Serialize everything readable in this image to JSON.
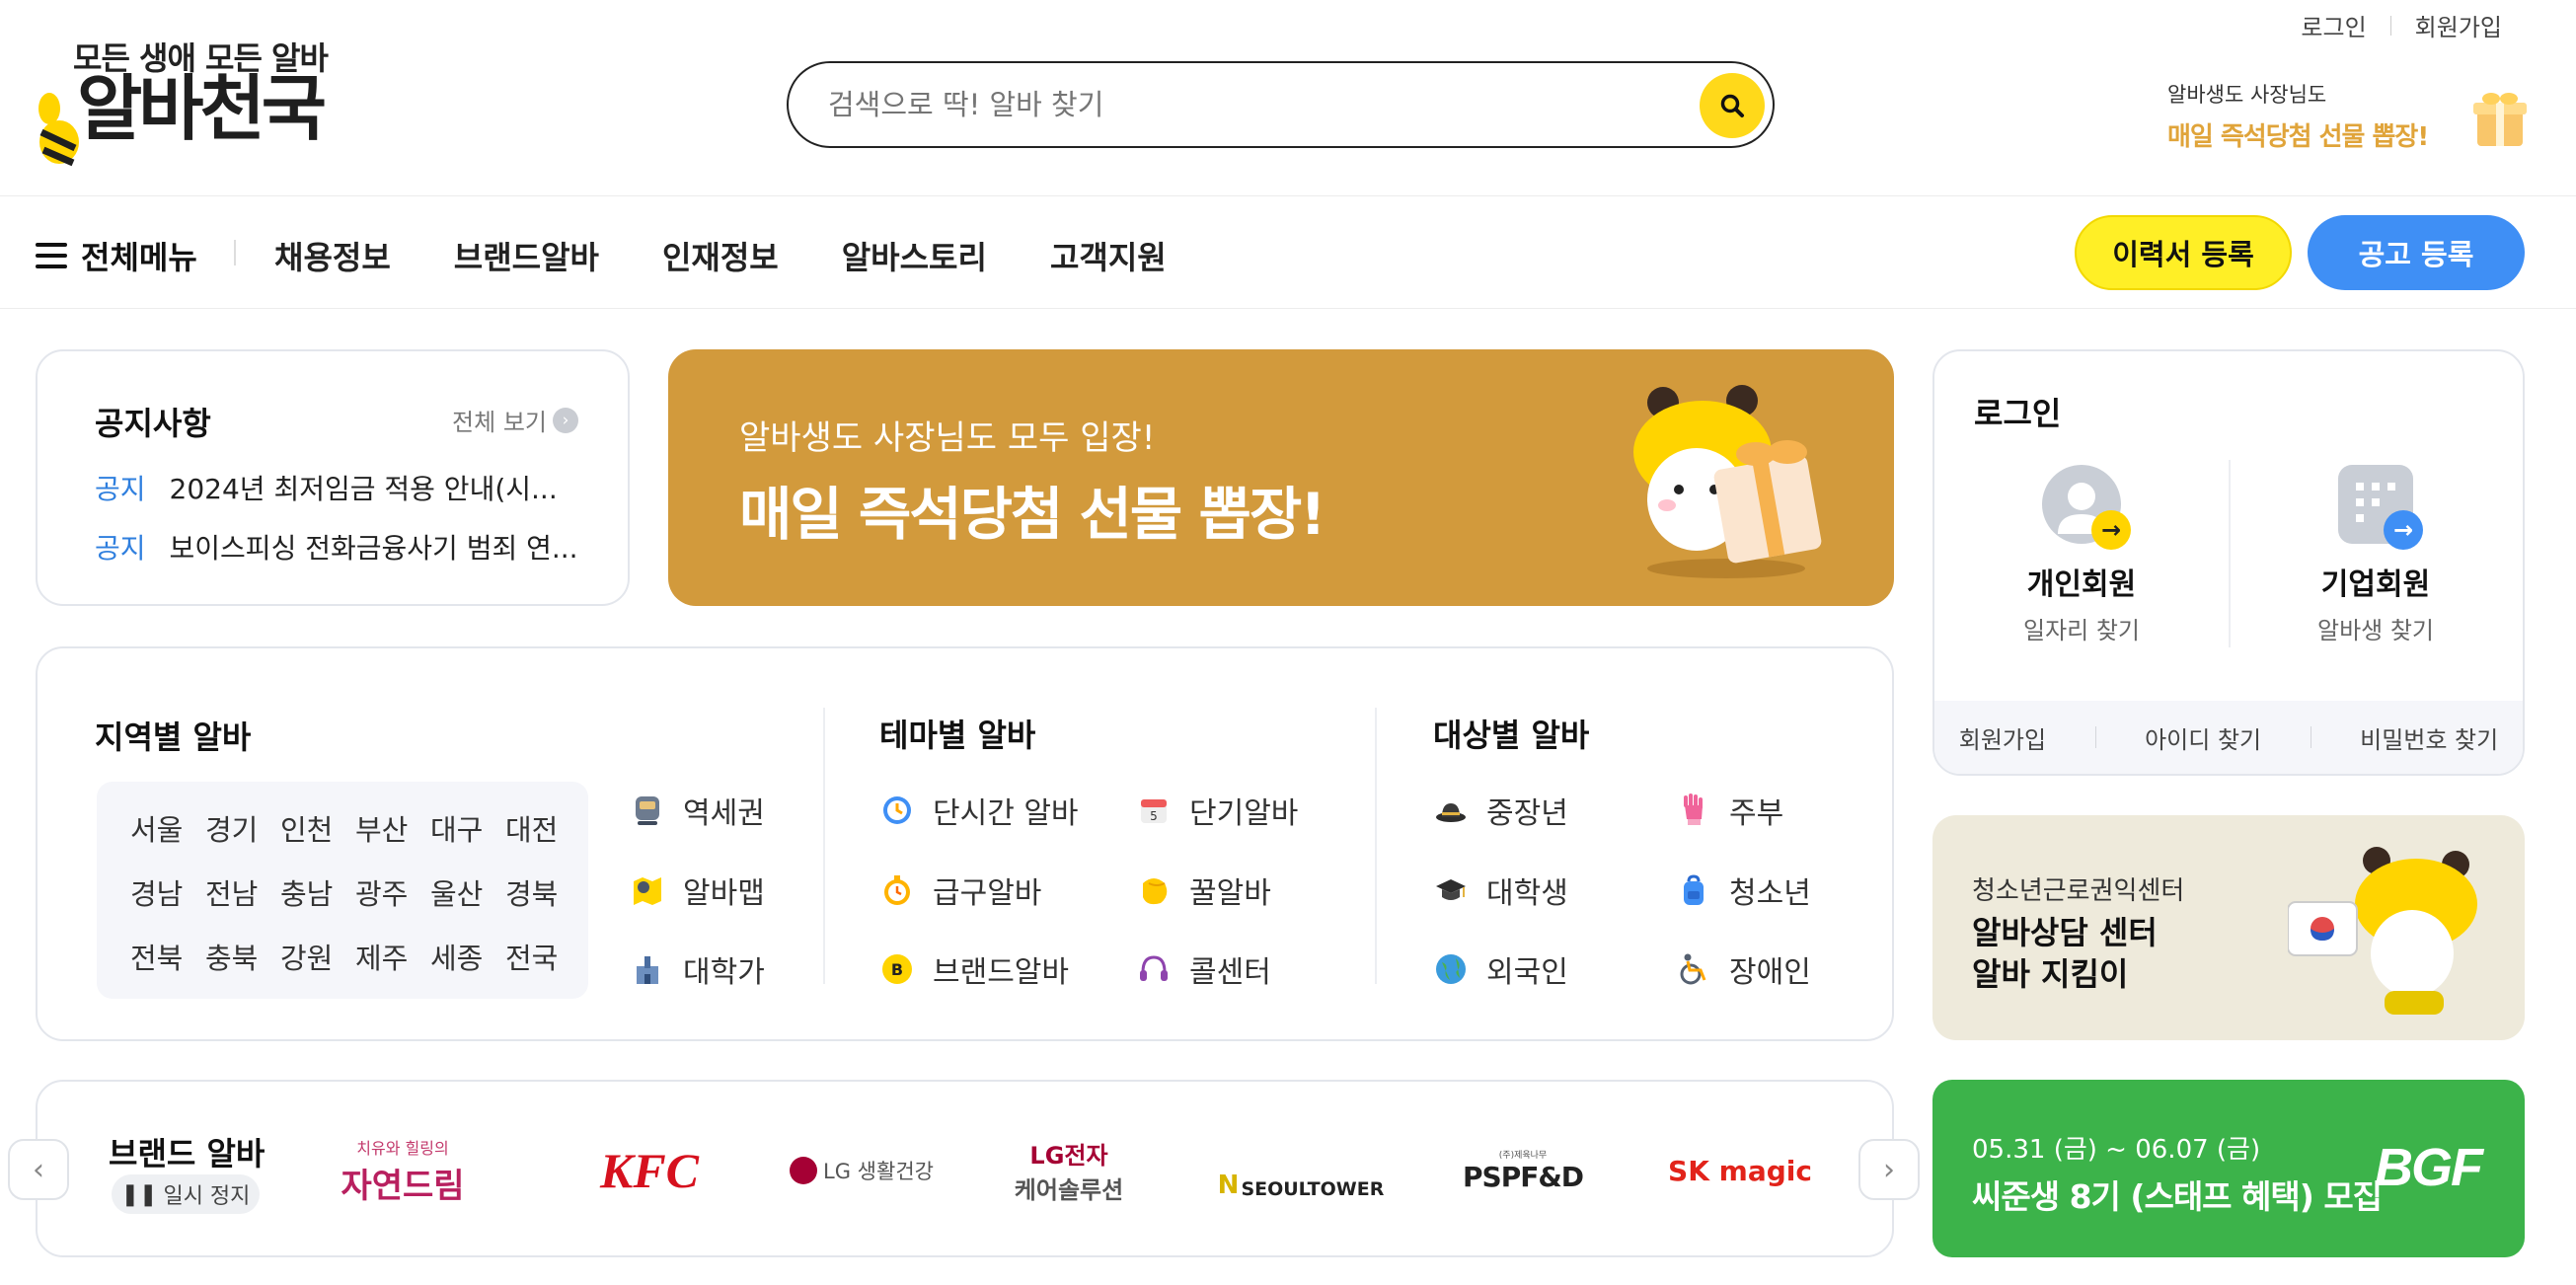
{
  "header": {
    "top_links": [
      "로그인",
      "회원가입"
    ],
    "logo_tagline": "모든 생애 모든 알바",
    "logo_word": "알바천국",
    "search_placeholder": "검색으로 딱! 알바 찾기",
    "promo_small": "알바생도 사장님도",
    "promo_big": "매일 즉석당첨 선물 뽑장!"
  },
  "nav": {
    "menu_all": "전체메뉴",
    "items": [
      "채용정보",
      "브랜드알바",
      "인재정보",
      "알바스토리",
      "고객지원"
    ],
    "btn_resume": "이력서 등록",
    "btn_post": "공고 등록"
  },
  "notice": {
    "title": "공지사항",
    "more": "전체 보기",
    "rows": [
      {
        "tag": "공지",
        "text": "2024년 최저임금 적용 안내(시..."
      },
      {
        "tag": "공지",
        "text": "보이스피싱 전화금융사기 범죄 연..."
      }
    ]
  },
  "banner": {
    "small": "알바생도 사장님도 모두 입장!",
    "big": "매일 즉석당첨 선물 뽑장!"
  },
  "categories": {
    "region_title": "지역별 알바",
    "regions": [
      [
        "서울",
        "경기",
        "인천",
        "부산",
        "대구",
        "대전"
      ],
      [
        "경남",
        "전남",
        "충남",
        "광주",
        "울산",
        "경북"
      ],
      [
        "전북",
        "충북",
        "강원",
        "제주",
        "세종",
        "전국"
      ]
    ],
    "region_extra": [
      {
        "label": "역세권",
        "icon": "subway-icon"
      },
      {
        "label": "알바맵",
        "icon": "map-pin-icon"
      },
      {
        "label": "대학가",
        "icon": "university-icon"
      }
    ],
    "theme_title": "테마별 알바",
    "themes": [
      {
        "label": "단시간 알바",
        "icon": "clock-icon"
      },
      {
        "label": "단기알바",
        "icon": "calendar-icon"
      },
      {
        "label": "급구알바",
        "icon": "stopwatch-icon"
      },
      {
        "label": "꿀알바",
        "icon": "honey-icon"
      },
      {
        "label": "브랜드알바",
        "icon": "brand-b-icon"
      },
      {
        "label": "콜센터",
        "icon": "headset-icon"
      }
    ],
    "target_title": "대상별 알바",
    "targets": [
      {
        "label": "중장년",
        "icon": "hat-icon"
      },
      {
        "label": "주부",
        "icon": "rubber-glove-icon"
      },
      {
        "label": "대학생",
        "icon": "graduation-cap-icon"
      },
      {
        "label": "청소년",
        "icon": "backpack-icon"
      },
      {
        "label": "외국인",
        "icon": "globe-icon"
      },
      {
        "label": "장애인",
        "icon": "wheelchair-icon"
      }
    ]
  },
  "login": {
    "title": "로그인",
    "personal_name": "개인회원",
    "personal_desc": "일자리 찾기",
    "company_name": "기업회원",
    "company_desc": "알바생 찾기",
    "footer": [
      "회원가입",
      "아이디 찾기",
      "비밀번호 찾기"
    ]
  },
  "side_banner_1": {
    "small": "청소년근로권익센터",
    "line1": "알바상담 센터",
    "line2": "알바 지킴이"
  },
  "brand": {
    "title": "브랜드 알바",
    "pause": "일시 정지",
    "logos": [
      {
        "top": "치유와 힐링의",
        "main": "자연드림"
      },
      {
        "main": "KFC"
      },
      {
        "main": "LG 생활건강"
      },
      {
        "top": "LG전자",
        "main": "케어솔루션"
      },
      {
        "top": "N",
        "main": "SEOULTOWER"
      },
      {
        "top": "(주)제육나무",
        "main": "PSPF&D"
      },
      {
        "main": "SK magic"
      }
    ]
  },
  "side_banner_2": {
    "date": "05.31 (금) ~ 06.07 (금)",
    "text": "씨준생 8기 (스태프 혜택) 모집",
    "logo": "BGF"
  },
  "colors": {
    "accent_yellow": "#ffd91a",
    "blue": "#3f8ff5",
    "banner_gold": "#d29a3c",
    "green": "#3cb34a"
  }
}
